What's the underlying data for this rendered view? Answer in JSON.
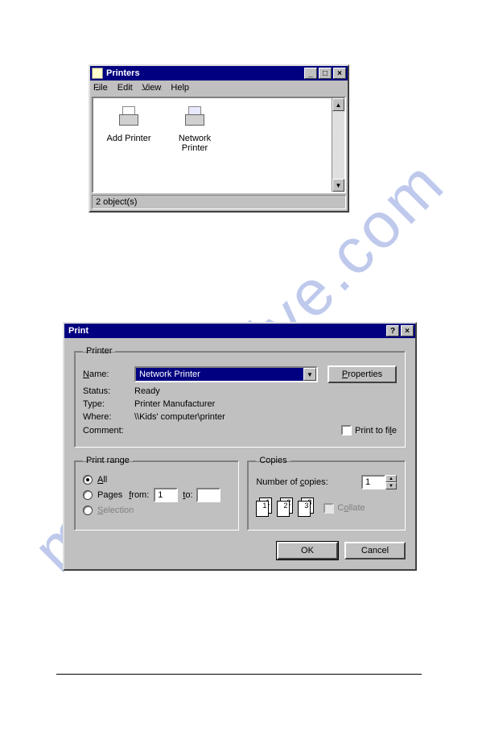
{
  "watermark": "manualshive.com",
  "printers_window": {
    "title": "Printers",
    "menu": {
      "file": "File",
      "edit": "Edit",
      "view": "View",
      "help": "Help"
    },
    "items": [
      {
        "label": "Add Printer"
      },
      {
        "label": "Network Printer"
      }
    ],
    "status": "2 object(s)"
  },
  "print_dialog": {
    "title": "Print",
    "printer_group": "Printer",
    "name_label": "Name:",
    "name_value": "Network Printer",
    "properties_btn": "Properties",
    "status_label": "Status:",
    "status_value": "Ready",
    "type_label": "Type:",
    "type_value": "Printer Manufacturer",
    "where_label": "Where:",
    "where_value": "\\\\Kids' computer\\printer",
    "comment_label": "Comment:",
    "print_to_file": "Print to file",
    "range_group": "Print range",
    "range_all": "All",
    "range_pages": "Pages",
    "from_label": "from:",
    "from_value": "1",
    "to_label": "to:",
    "to_value": "",
    "range_selection": "Selection",
    "copies_group": "Copies",
    "copies_label": "Number of copies:",
    "copies_value": "1",
    "collate_label": "Collate",
    "ok_btn": "OK",
    "cancel_btn": "Cancel"
  }
}
